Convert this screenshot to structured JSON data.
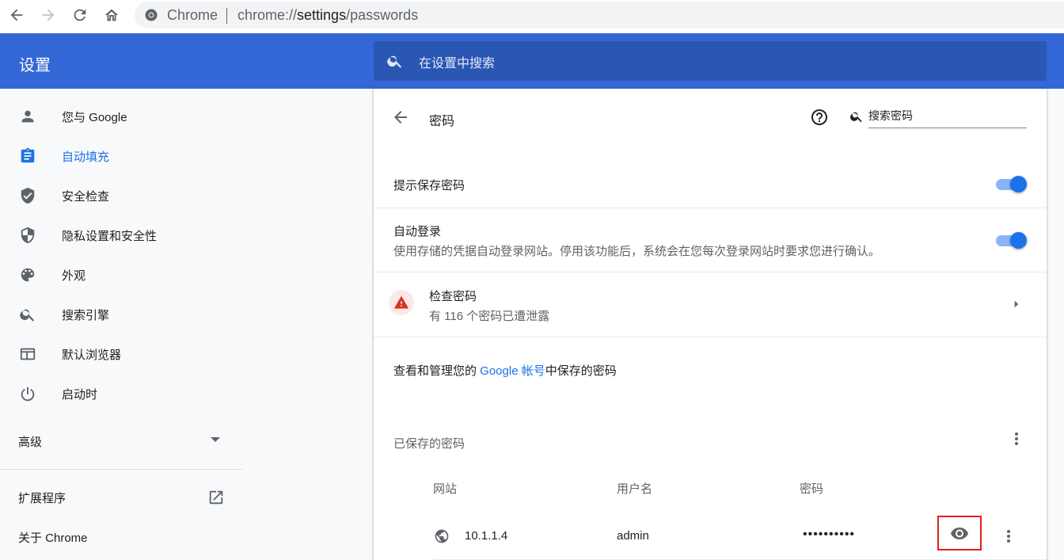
{
  "browser": {
    "site_name": "Chrome",
    "url_prefix": "chrome://",
    "url_host": "settings",
    "url_path": "/passwords"
  },
  "header": {
    "title": "设置",
    "search_placeholder": "在设置中搜索"
  },
  "sidebar": {
    "items": [
      {
        "label": "您与 Google",
        "icon": "person-icon"
      },
      {
        "label": "自动填充",
        "icon": "assignment-icon",
        "active": true
      },
      {
        "label": "安全检查",
        "icon": "shield-check-icon"
      },
      {
        "label": "隐私设置和安全性",
        "icon": "shield-half-icon"
      },
      {
        "label": "外观",
        "icon": "palette-icon"
      },
      {
        "label": "搜索引擎",
        "icon": "search-icon"
      },
      {
        "label": "默认浏览器",
        "icon": "browser-window-icon"
      },
      {
        "label": "启动时",
        "icon": "power-icon"
      }
    ],
    "advanced_label": "高级",
    "extensions_label": "扩展程序",
    "about_label": "关于 Chrome"
  },
  "passwords": {
    "title": "密码",
    "search_placeholder": "搜索密码",
    "offer_to_save_label": "提示保存密码",
    "offer_to_save_on": true,
    "auto_signin_label": "自动登录",
    "auto_signin_desc": "使用存储的凭据自动登录网站。停用该功能后，系统会在您每次登录网站时要求您进行确认。",
    "auto_signin_on": true,
    "check_title": "检查密码",
    "check_sub": "有 116 个密码已遭泄露",
    "manage_prefix": "查看和管理您的 ",
    "manage_link": "Google 帐号",
    "manage_suffix": "中保存的密码",
    "saved_title": "已保存的密码",
    "col_site": "网站",
    "col_user": "用户名",
    "col_password": "密码",
    "rows": [
      {
        "site": "10.1.1.4",
        "username": "admin",
        "password_mask": "••••••••••"
      }
    ]
  },
  "colors": {
    "header_blue": "#3367d6",
    "search_box": "#2a56b4",
    "accent": "#1a73e8",
    "warning_red": "#d93025",
    "highlight_box": "#e02020"
  }
}
